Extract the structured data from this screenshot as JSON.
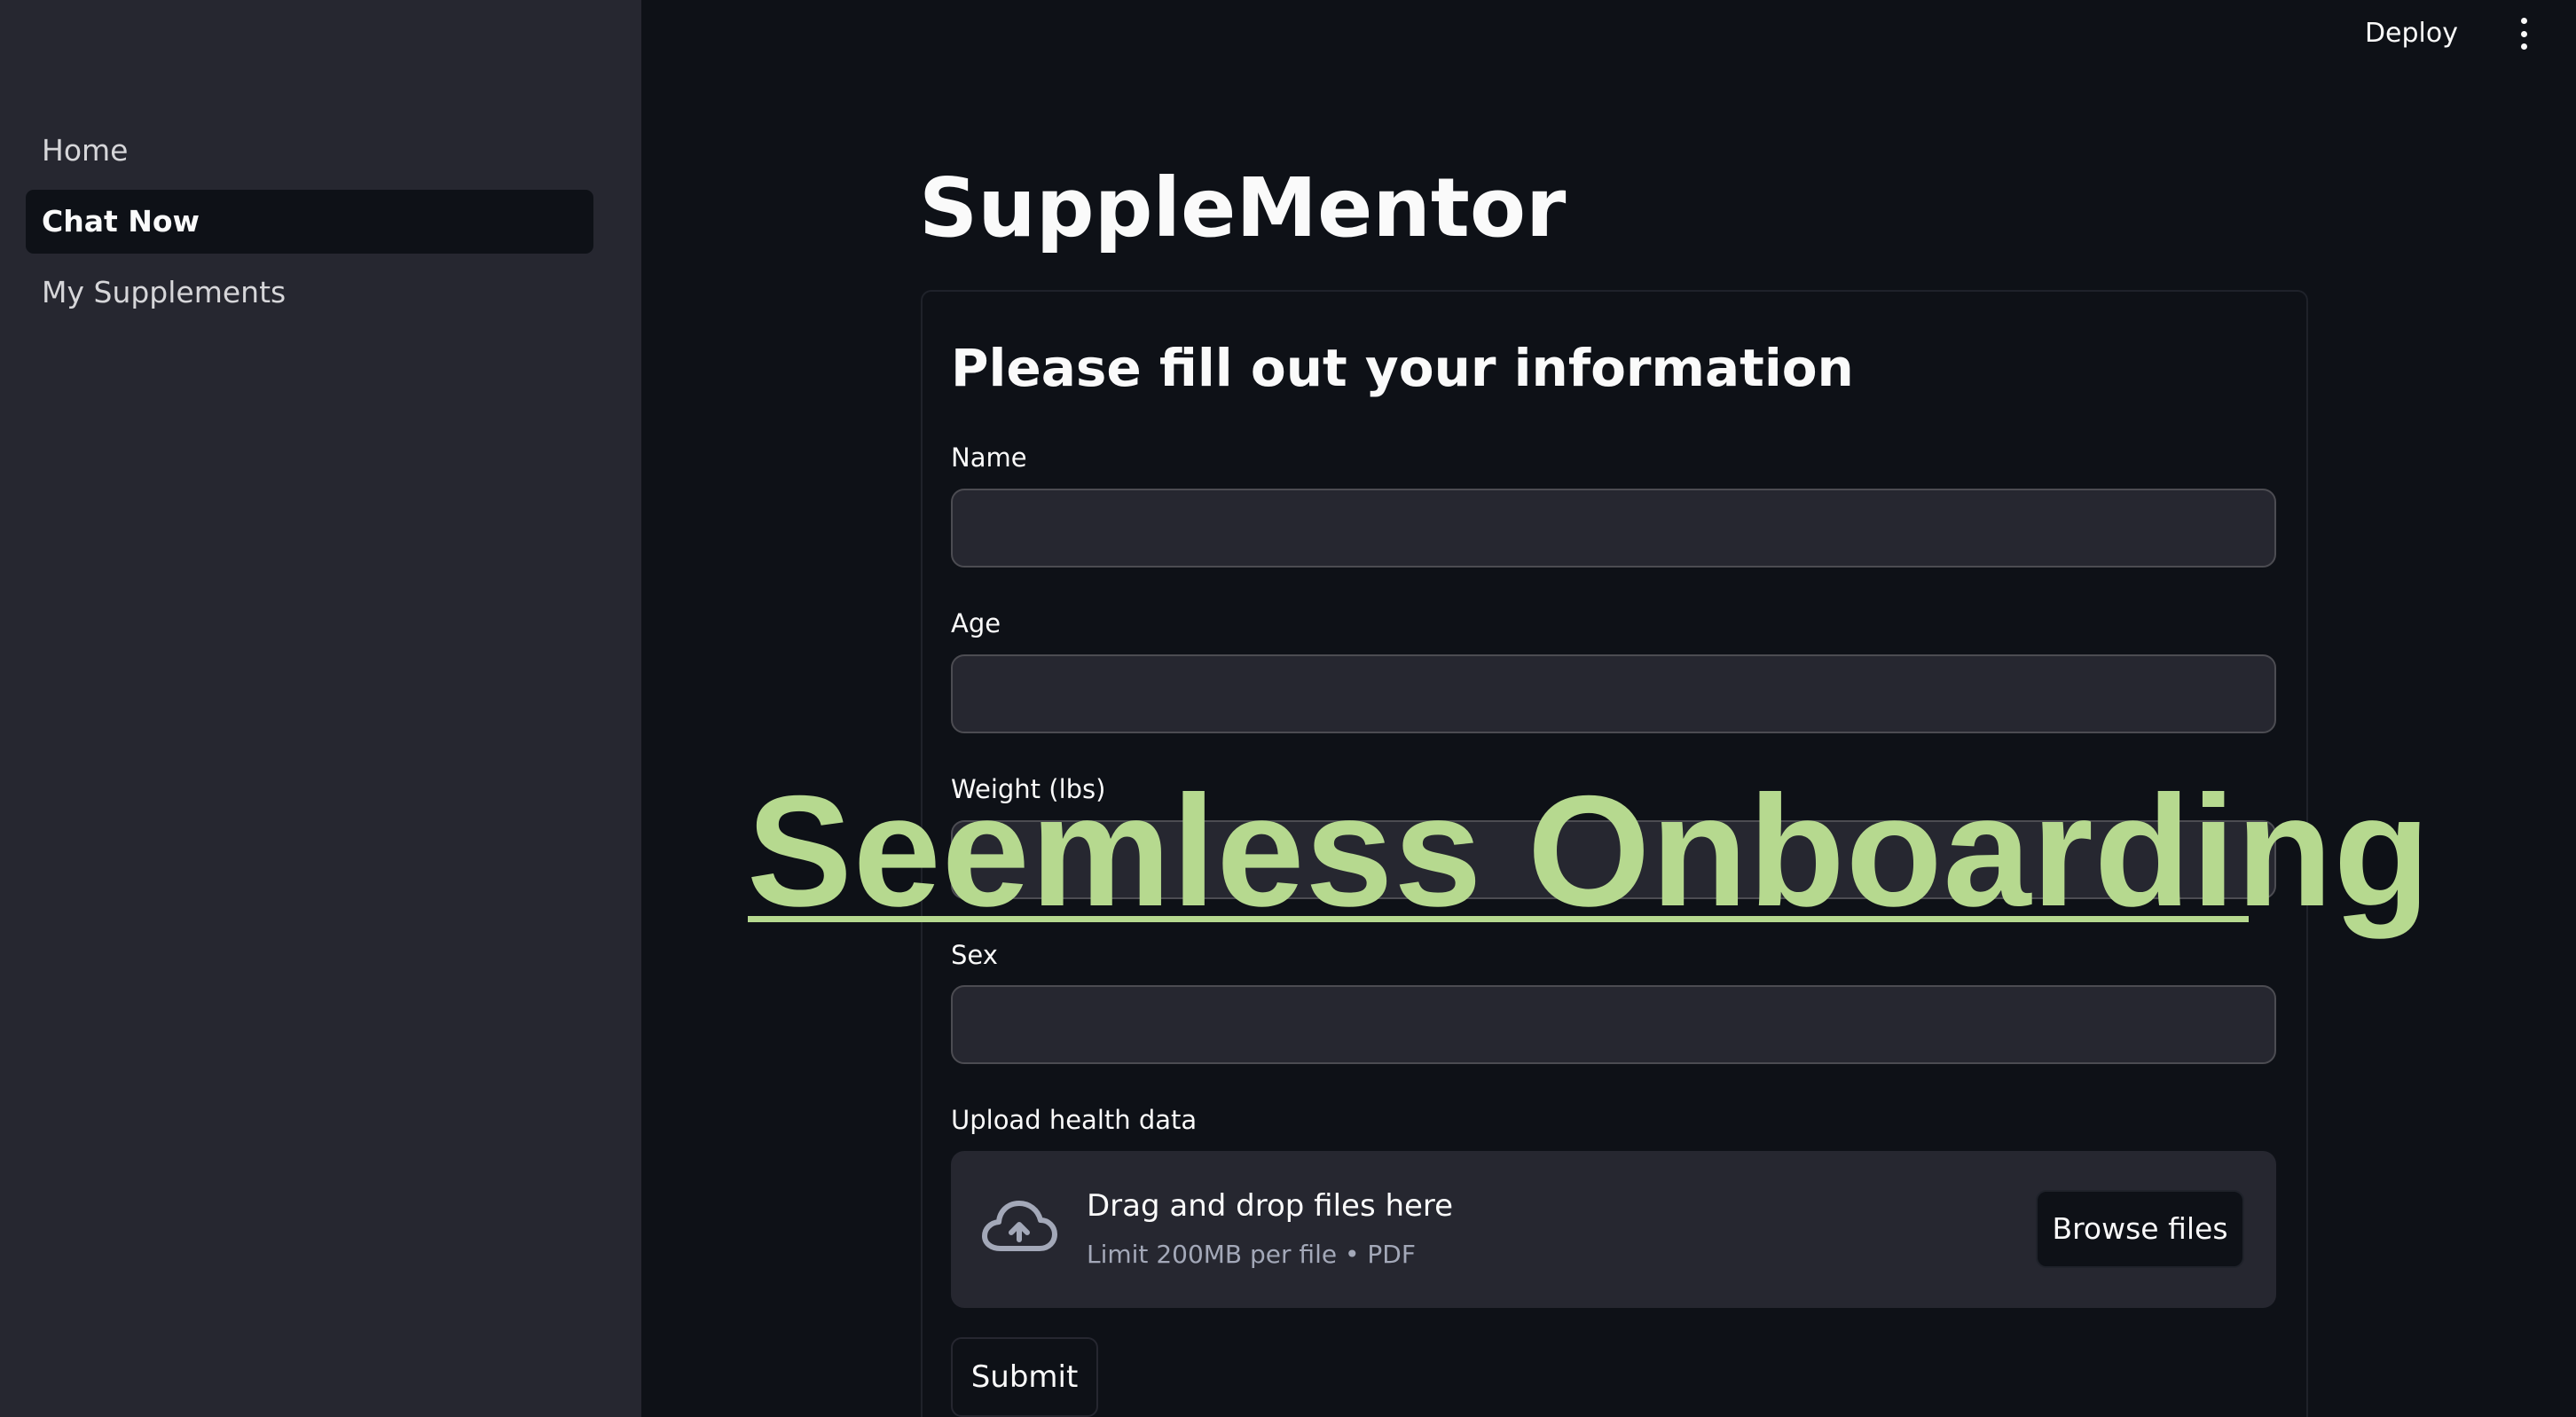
{
  "sidebar": {
    "items": [
      {
        "label": "Home",
        "active": false
      },
      {
        "label": "Chat Now",
        "active": true
      },
      {
        "label": "My Supplements",
        "active": false
      }
    ]
  },
  "header": {
    "deploy_label": "Deploy",
    "menu_icon": "kebab-menu-icon"
  },
  "main": {
    "title": "SuppleMentor",
    "form": {
      "heading": "Please fill out your information",
      "fields": [
        {
          "label": "Name",
          "value": "",
          "placeholder": ""
        },
        {
          "label": "Age",
          "value": "",
          "placeholder": ""
        },
        {
          "label": "Weight (lbs)",
          "value": "",
          "placeholder": ""
        },
        {
          "label": "Sex",
          "value": "",
          "placeholder": ""
        }
      ],
      "upload": {
        "label": "Upload health data",
        "drop_text": "Drag and drop files here",
        "limit_text": "Limit 200MB per file • PDF",
        "browse_label": "Browse files",
        "icon": "cloud-upload-icon"
      },
      "submit_label": "Submit"
    }
  },
  "overlay": {
    "text": "Seemless Onboarding",
    "color": "#b6d98f"
  },
  "colors": {
    "background": "#0e1117",
    "sidebar": "#262730",
    "input": "#262730",
    "text": "#fafafa"
  }
}
